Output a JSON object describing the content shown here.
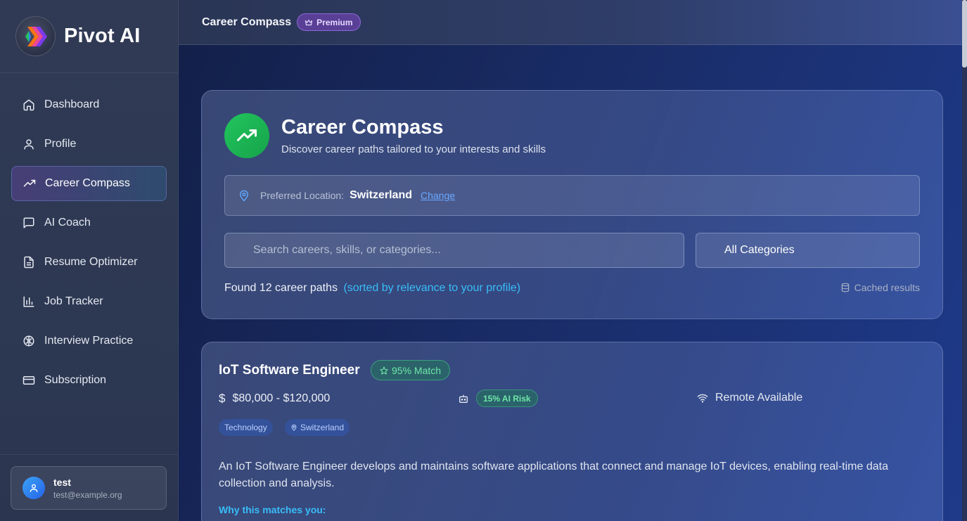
{
  "app": {
    "name": "Pivot AI"
  },
  "sidebar": {
    "items": [
      {
        "label": "Dashboard",
        "icon": "home-icon"
      },
      {
        "label": "Profile",
        "icon": "user-icon"
      },
      {
        "label": "Career Compass",
        "icon": "trending-up-icon",
        "active": true
      },
      {
        "label": "AI Coach",
        "icon": "message-square-icon"
      },
      {
        "label": "Resume Optimizer",
        "icon": "file-text-icon"
      },
      {
        "label": "Job Tracker",
        "icon": "bar-chart-icon"
      },
      {
        "label": "Interview Practice",
        "icon": "brain-icon"
      },
      {
        "label": "Subscription",
        "icon": "credit-card-icon"
      }
    ],
    "user": {
      "name": "test",
      "email": "test@example.org"
    }
  },
  "topbar": {
    "title": "Career Compass",
    "badge": "Premium"
  },
  "hero": {
    "title": "Career Compass",
    "subtitle": "Discover career paths tailored to your interests and skills"
  },
  "location": {
    "label": "Preferred Location:",
    "value": "Switzerland",
    "change_label": "Change"
  },
  "search": {
    "placeholder": "Search careers, skills, or categories...",
    "category": "All Categories"
  },
  "results": {
    "found": "Found 12 career paths",
    "sorted_note": "(sorted by relevance to your profile)",
    "cached": "Cached results"
  },
  "card": {
    "title": "IoT Software Engineer",
    "match": "95% Match",
    "salary": "$80,000 - $120,000",
    "ai_risk": "15% AI Risk",
    "remote": "Remote Available",
    "tags": [
      "Technology",
      "Switzerland"
    ],
    "description": "An IoT Software Engineer develops and maintains software applications that connect and manage IoT devices, enabling real-time data collection and analysis.",
    "why_label": "Why this matches you:"
  },
  "colors": {
    "accent_green": "#22c55e",
    "accent_cyan": "#38bdf8",
    "premium_purple": "#5a3f96"
  }
}
